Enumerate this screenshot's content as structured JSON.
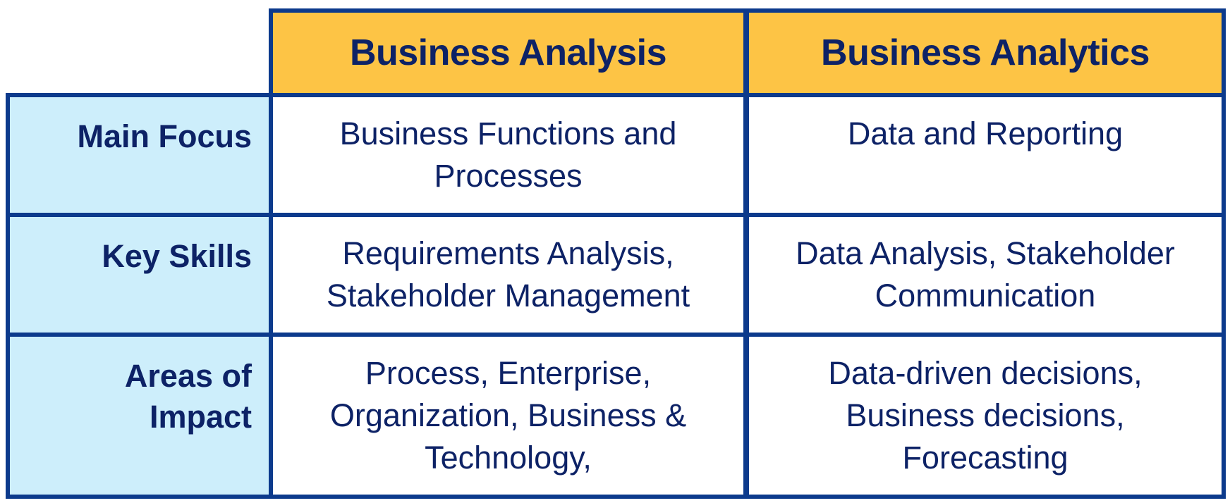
{
  "header": {
    "col1": "Business Analysis",
    "col2": "Business Analytics"
  },
  "rows": [
    {
      "label_lines": [
        "Main Focus"
      ],
      "col1_lines": [
        "Business Functions and",
        "Processes"
      ],
      "col2_lines": [
        "Data and Reporting"
      ]
    },
    {
      "label_lines": [
        "Key Skills"
      ],
      "col1_lines": [
        "Requirements Analysis,",
        "Stakeholder Management"
      ],
      "col2_lines": [
        "Data Analysis, Stakeholder",
        "Communication"
      ]
    },
    {
      "label_lines": [
        "Areas of",
        "Impact"
      ],
      "col1_lines": [
        "Process, Enterprise,",
        "Organization, Business &",
        "Technology,"
      ],
      "col2_lines": [
        "Data-driven decisions,",
        "Business decisions,",
        "Forecasting"
      ]
    }
  ],
  "colors": {
    "header_bg": "#fdc445",
    "label_bg": "#cdeefb",
    "border": "#0c3a8c",
    "text": "#0d2266"
  }
}
